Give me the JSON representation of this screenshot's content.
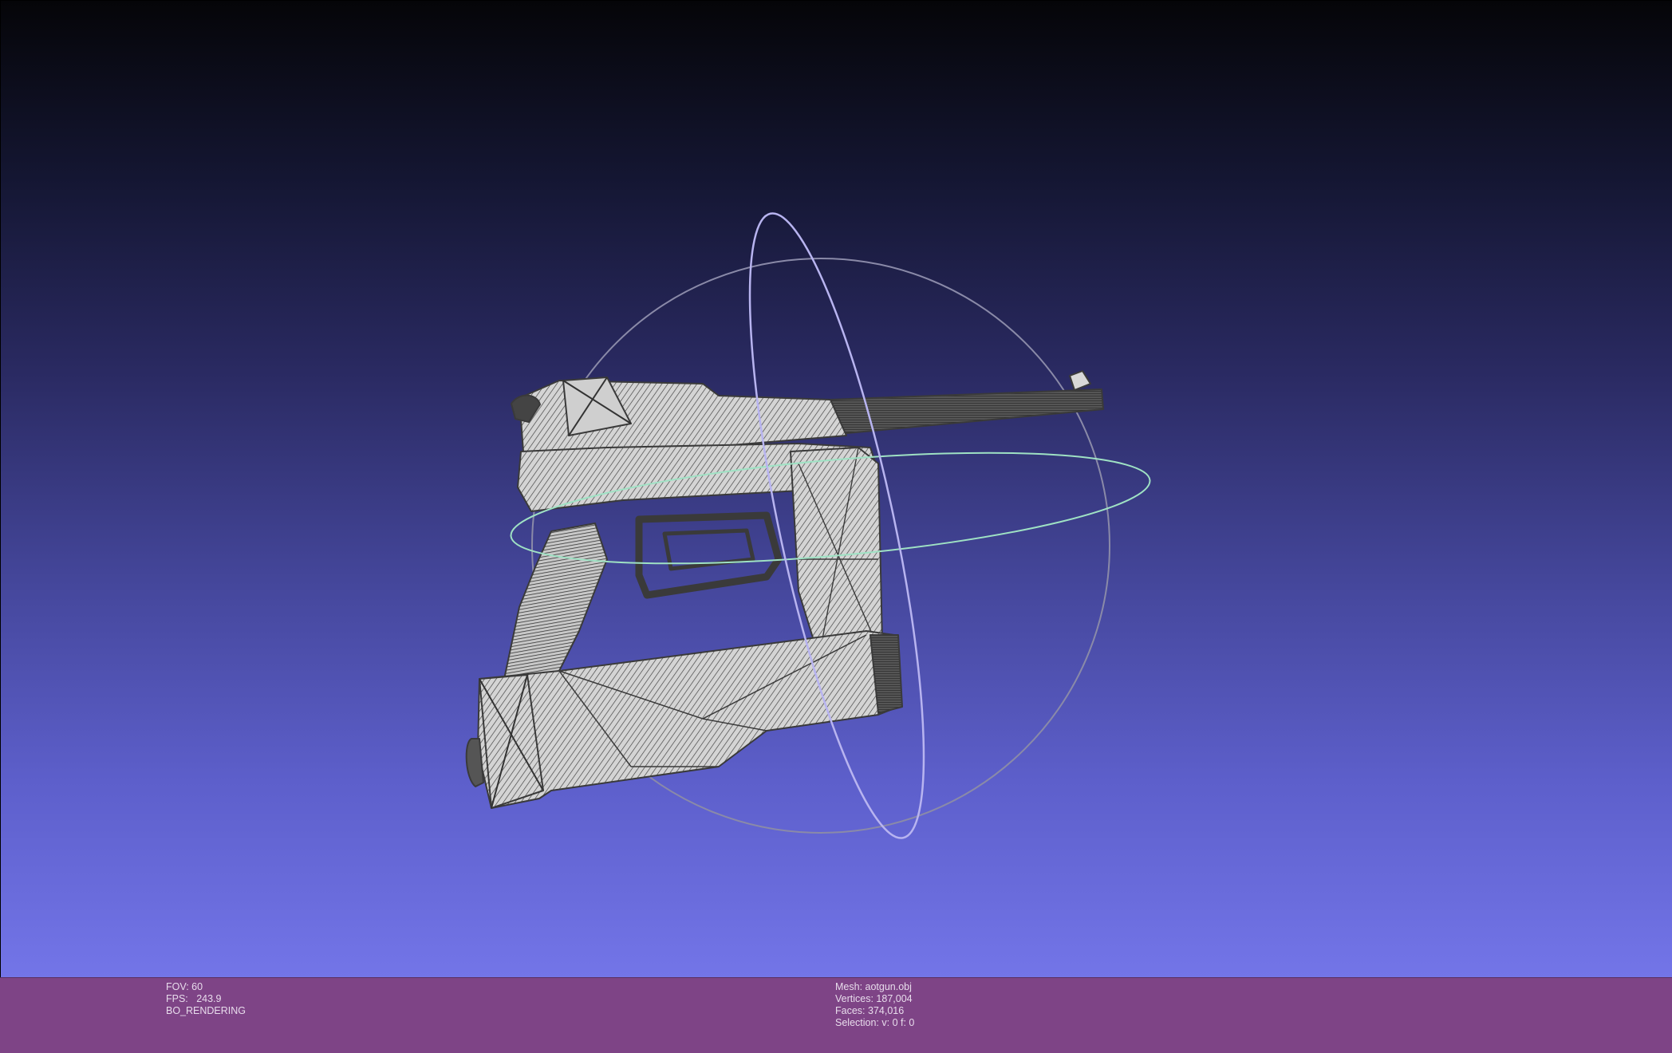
{
  "viewer": {
    "fov_line": "FOV: 60",
    "fps_line": "FPS:   243.9",
    "render_mode": "BO_RENDERING"
  },
  "mesh_info": {
    "mesh_line": "Mesh: aotgun.obj",
    "vertices_line": "Vertices: 187,004",
    "faces_line": "Faces: 374,016",
    "selection_line": "Selection: v: 0 f: 0"
  },
  "colors": {
    "status_bar": "#7e4486",
    "trackball_ring_vertical": "#b8b4f0",
    "trackball_ring_horizontal": "#9fe2c4",
    "trackball_ring_outer": "#8a8aa8",
    "mesh_face": "#d6d6d6",
    "mesh_wire": "#3c3c3c"
  },
  "icons": {
    "trackball": "trackball-icon",
    "model": "pistol-mesh-icon"
  }
}
